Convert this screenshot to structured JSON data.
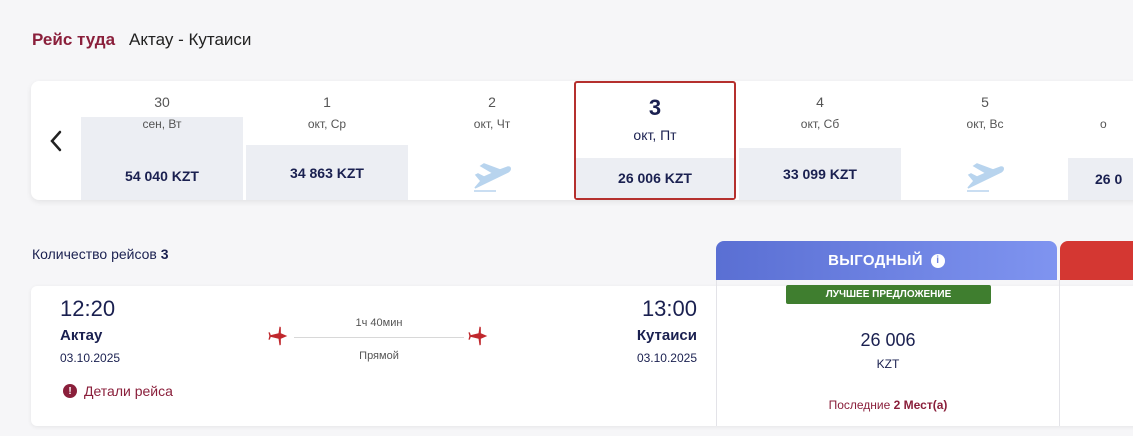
{
  "header": {
    "title": "Рейс туда",
    "route": "Актау - Кутаиси"
  },
  "date_strip": {
    "days": [
      {
        "num": "30",
        "sub": "сен, Вт",
        "price": "54 040 KZT",
        "has_price": true
      },
      {
        "num": "1",
        "sub": "окт, Ср",
        "price": "34 863 KZT",
        "has_price": true
      },
      {
        "num": "2",
        "sub": "окт, Чт",
        "price": "",
        "has_price": false
      },
      {
        "num": "3",
        "sub": "окт, Пт",
        "price": "26 006 KZT",
        "has_price": true,
        "selected": true
      },
      {
        "num": "4",
        "sub": "окт, Сб",
        "price": "33 099 KZT",
        "has_price": true
      },
      {
        "num": "5",
        "sub": "окт, Вс",
        "price": "",
        "has_price": false
      },
      {
        "num": "",
        "sub": "о",
        "price": "26 0",
        "has_price": true
      }
    ]
  },
  "results": {
    "count_label": "Количество рейсов",
    "count": "3"
  },
  "fare_tabs": {
    "best_label": "ВЫГОДНЫЙ"
  },
  "flight": {
    "dep_time": "12:20",
    "dep_city": "Актау",
    "dep_date": "03.10.2025",
    "arr_time": "13:00",
    "arr_city": "Кутаиси",
    "arr_date": "03.10.2025",
    "duration": "1ч 40мин",
    "type": "Прямой",
    "details_label": "Детали рейса"
  },
  "fare": {
    "badge": "ЛУЧШЕЕ ПРЕДЛОЖЕНИЕ",
    "amount": "26 006",
    "currency": "KZT",
    "seats_prefix": "Последние",
    "seats_count": "2 Мест(а)"
  },
  "colors": {
    "brand": "#8a1f3b",
    "navy": "#1a2050",
    "best_tab": "#6a7fe0",
    "badge_green": "#3f7e2f",
    "selected_border": "#b5302e"
  }
}
